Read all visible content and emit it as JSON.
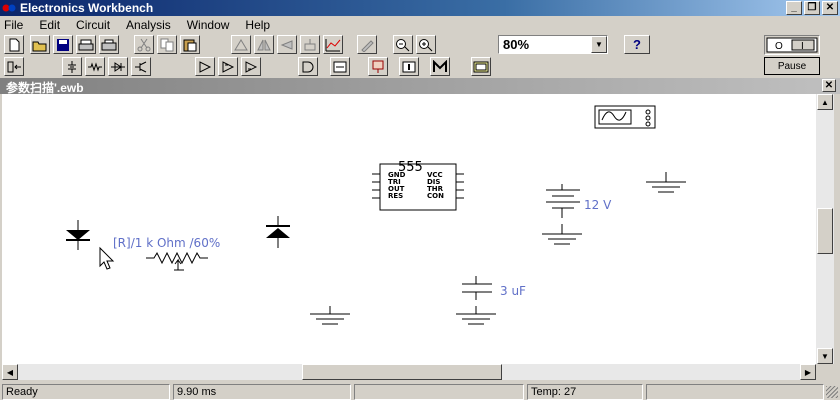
{
  "window": {
    "title": "Electronics Workbench"
  },
  "menu": [
    "File",
    "Edit",
    "Circuit",
    "Analysis",
    "Window",
    "Help"
  ],
  "toolbar": {
    "zoom": "80%",
    "help_label": "?",
    "pause_label": "Pause"
  },
  "document": {
    "title": "参数扫描'.ewb"
  },
  "circuit": {
    "ic_number": "555",
    "ic_pins_left": [
      "GND",
      "TRI",
      "OUT",
      "RES"
    ],
    "ic_pins_right": [
      "VCC",
      "DIS",
      "THR",
      "CON"
    ],
    "resistor_label": "[R]/1 k Ohm /60%",
    "battery_label": "12 V",
    "capacitor_label": "3 uF"
  },
  "status": {
    "state": "Ready",
    "time": "9.90 ms",
    "temp": "Temp:  27"
  },
  "colors": {
    "title_bar": "#0a246a",
    "label_color": "#6070c8"
  }
}
